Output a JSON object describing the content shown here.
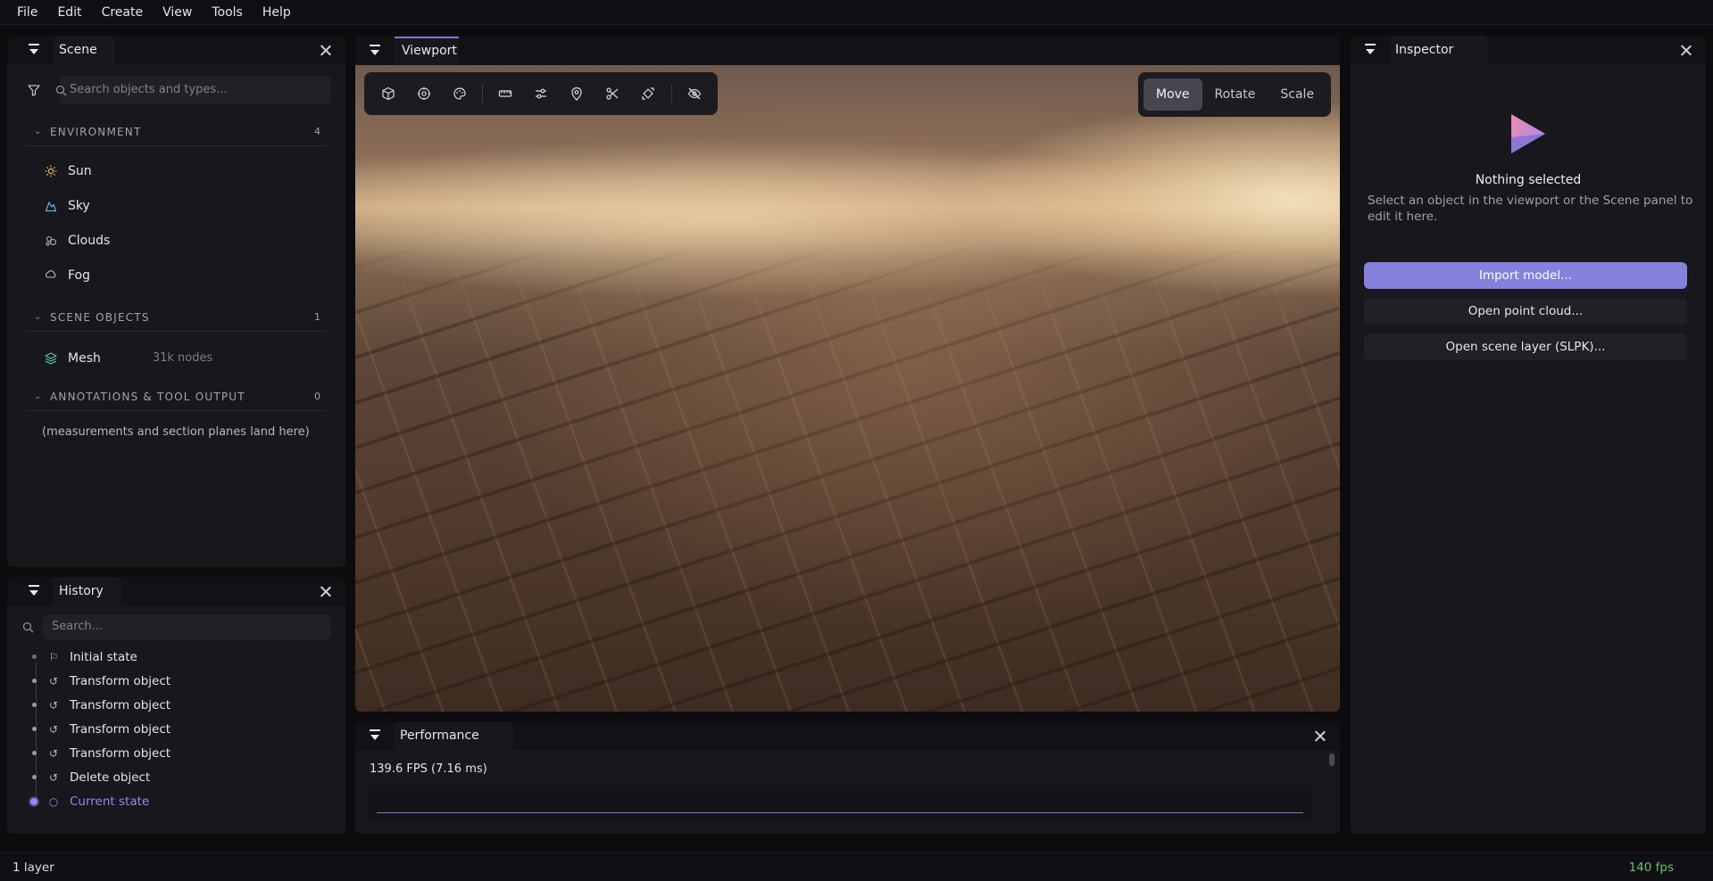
{
  "menu": [
    "File",
    "Edit",
    "Create",
    "View",
    "Tools",
    "Help"
  ],
  "scene": {
    "title": "Scene",
    "search_placeholder": "Search objects and types...",
    "sections": {
      "environment": {
        "label": "ENVIRONMENT",
        "count": "4"
      },
      "scene_objects": {
        "label": "SCENE OBJECTS",
        "count": "1"
      },
      "annotations": {
        "label": "ANNOTATIONS & TOOL OUTPUT",
        "count": "0"
      }
    },
    "environment_items": [
      "Sun",
      "Sky",
      "Clouds",
      "Fog"
    ],
    "mesh": {
      "label": "Mesh",
      "meta": "31k nodes"
    },
    "annotations_hint": "(measurements and section planes land here)"
  },
  "history": {
    "title": "History",
    "search_placeholder": "Search...",
    "items": [
      "Initial state",
      "Transform object",
      "Transform object",
      "Transform object",
      "Transform object",
      "Delete object",
      "Current state"
    ]
  },
  "viewport": {
    "title": "Viewport",
    "modes": [
      "Move",
      "Rotate",
      "Scale"
    ],
    "active_mode": "Move",
    "tool_icons": [
      "cube-icon",
      "globe-icon",
      "palette-icon",
      "ruler-icon",
      "sliders-icon",
      "map-pin-icon",
      "scissors-icon",
      "box-arrows-icon",
      "eye-off-icon"
    ]
  },
  "performance": {
    "title": "Performance",
    "fps_text": "139.6 FPS  (7.16 ms)"
  },
  "inspector": {
    "title": "Inspector",
    "empty_title": "Nothing selected",
    "empty_desc": "Select an object in the viewport or the Scene panel to edit it here.",
    "buttons": {
      "import": "Import model...",
      "point_cloud": "Open point cloud...",
      "scene_layer": "Open scene layer (SLPK)..."
    }
  },
  "status": {
    "layers": "1 layer",
    "fps": "140 fps"
  },
  "colors": {
    "accent": "#7c79d9",
    "primary_button": "#8481dd",
    "fps_ok": "#6cc36c"
  }
}
